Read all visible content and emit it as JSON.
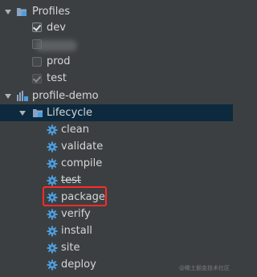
{
  "tree": {
    "profiles": {
      "label": "Profiles",
      "items": [
        {
          "label": "dev",
          "checked": true
        },
        {
          "label": "",
          "checked": false
        },
        {
          "label": "prod",
          "checked": false
        },
        {
          "label": "test",
          "checked": true
        }
      ]
    },
    "project": {
      "label": "profile-demo",
      "lifecycle": {
        "label": "Lifecycle",
        "phases": [
          "clean",
          "validate",
          "compile",
          "test",
          "package",
          "verify",
          "install",
          "site",
          "deploy"
        ]
      }
    }
  },
  "watermark": "@稀土掘金技术社区",
  "colors": {
    "background": "#3c3f41",
    "selection": "#0d293e",
    "gear": "#4c9ee0",
    "highlight_box": "#ff2a2a"
  }
}
